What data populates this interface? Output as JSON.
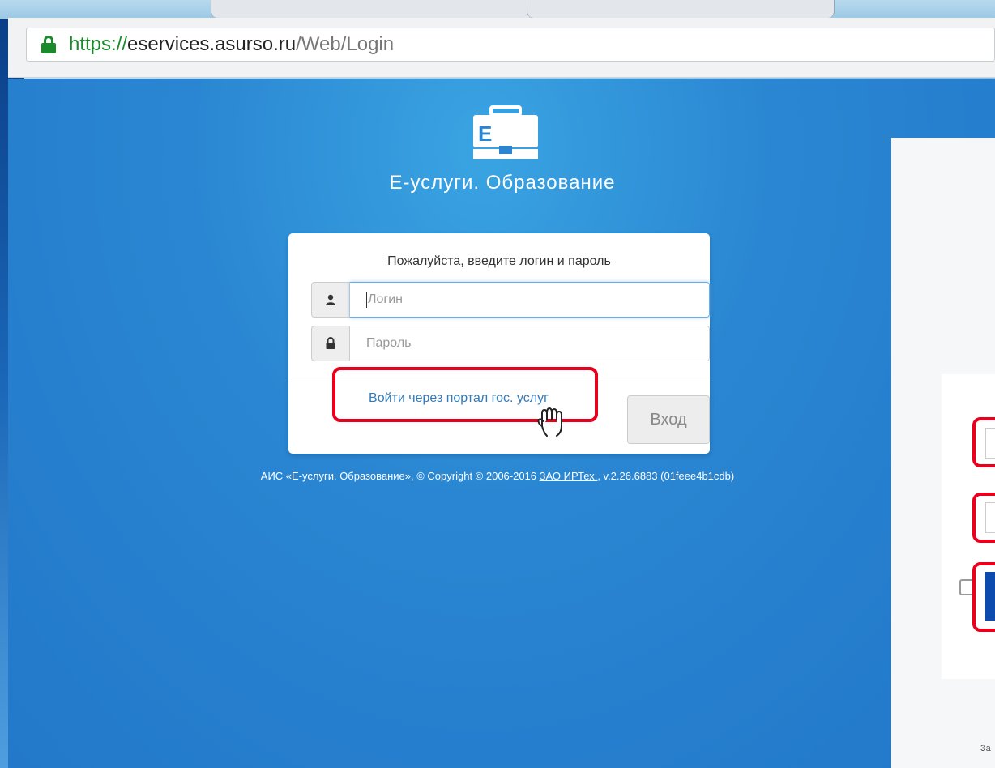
{
  "browser": {
    "url_scheme": "https://",
    "url_host": "eservices.asurso.ru",
    "url_path": "/Web/Login"
  },
  "app": {
    "title": "Е-услуги. Образование"
  },
  "login_form": {
    "prompt": "Пожалуйста, введите логин и пароль",
    "login_placeholder": "Логин",
    "password_placeholder": "Пароль",
    "gosuslugi_link": "Войти через портал гос. услуг",
    "submit_label": "Вход"
  },
  "footer": {
    "text_prefix": "АИС «Е-услуги. Образование», © Copyright © 2006-2016 ",
    "company_link": "ЗАО ИРТех.",
    "text_suffix": ", v.2.26.6883 (01feee4b1cdb)"
  },
  "right_panel": {
    "footer_fragment": "За"
  },
  "colors": {
    "page_bg": "#2277c9",
    "link": "#337ab7",
    "highlight": "#e8001c",
    "secure": "#1b8a2b"
  }
}
